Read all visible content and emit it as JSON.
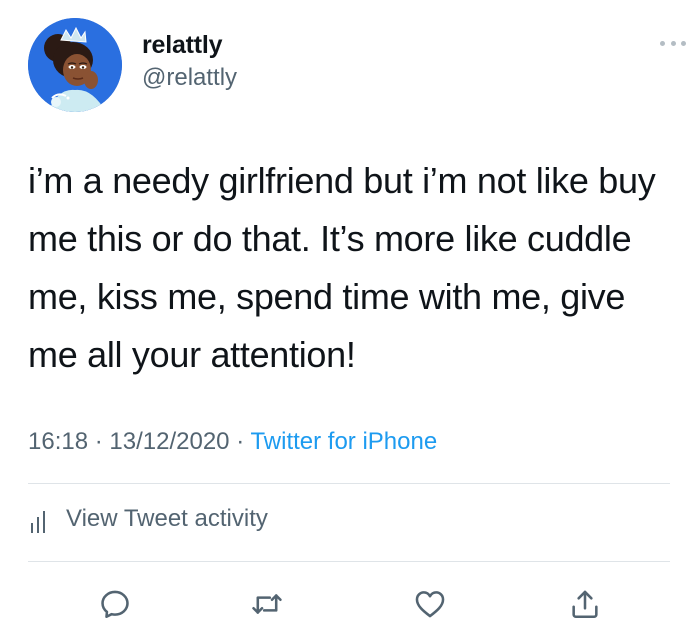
{
  "user": {
    "display_name": "relattly",
    "handle": "@relattly",
    "avatar_icon": "cartoon-princess-avatar"
  },
  "tweet": {
    "text": "i’m a needy girlfriend but i’m not like buy me this or do that. It’s more like cuddle me, kiss me, spend time with me, give me all your attention!",
    "time": "16:18",
    "date": "13/12/2020",
    "separator": "·",
    "source": "Twitter for iPhone"
  },
  "activity": {
    "label": "View Tweet activity",
    "icon": "bar-chart-icon"
  },
  "actions": [
    {
      "icon": "reply-icon"
    },
    {
      "icon": "retweet-icon"
    },
    {
      "icon": "like-icon"
    },
    {
      "icon": "share-icon"
    }
  ],
  "menu": {
    "icon": "more-options-icon"
  },
  "colors": {
    "text": "#0f1419",
    "secondary": "#536471",
    "accent": "#1d9bf0",
    "divider": "#dfe4e8"
  }
}
